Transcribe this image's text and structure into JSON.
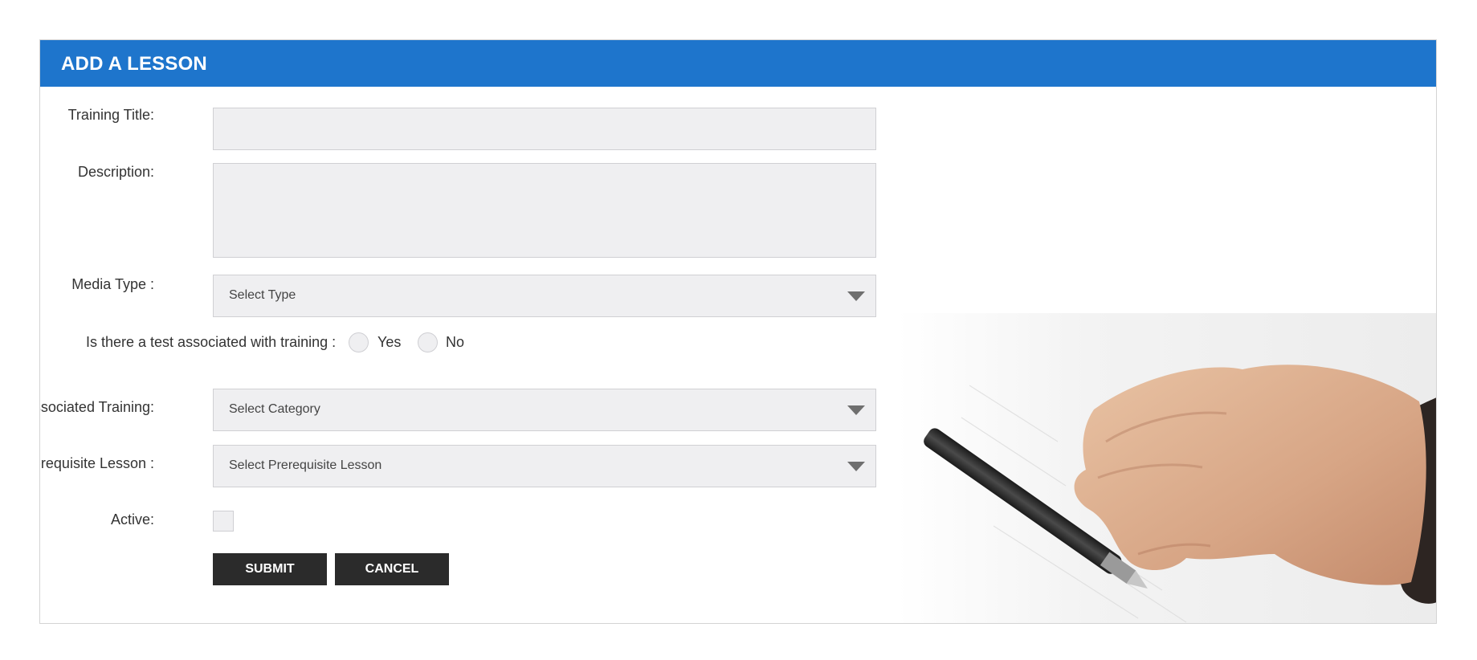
{
  "panel": {
    "title": "ADD A LESSON"
  },
  "form": {
    "training_title": {
      "label": "Training Title:",
      "value": ""
    },
    "description": {
      "label": "Description:",
      "value": ""
    },
    "media_type": {
      "label": "Media Type :",
      "selected": "Select Type"
    },
    "test_question": {
      "label": "Is there a test associated with training :",
      "options": [
        "Yes",
        "No"
      ]
    },
    "associated_training": {
      "label": "Associated Training:",
      "selected": "Select Category"
    },
    "prerequisite_lesson": {
      "label": "Prerequisite Lesson :",
      "selected": "Select Prerequisite Lesson"
    },
    "active": {
      "label": "Active:",
      "checked": false
    }
  },
  "buttons": {
    "submit": "SUBMIT",
    "cancel": "CANCEL"
  },
  "colors": {
    "header": "#1e75cc",
    "field_bg": "#efeff1",
    "button_bg": "#2b2b2b"
  },
  "icons": {
    "select_arrow": "caret-down-icon",
    "illustration": "hand-writing-with-pen-image"
  }
}
